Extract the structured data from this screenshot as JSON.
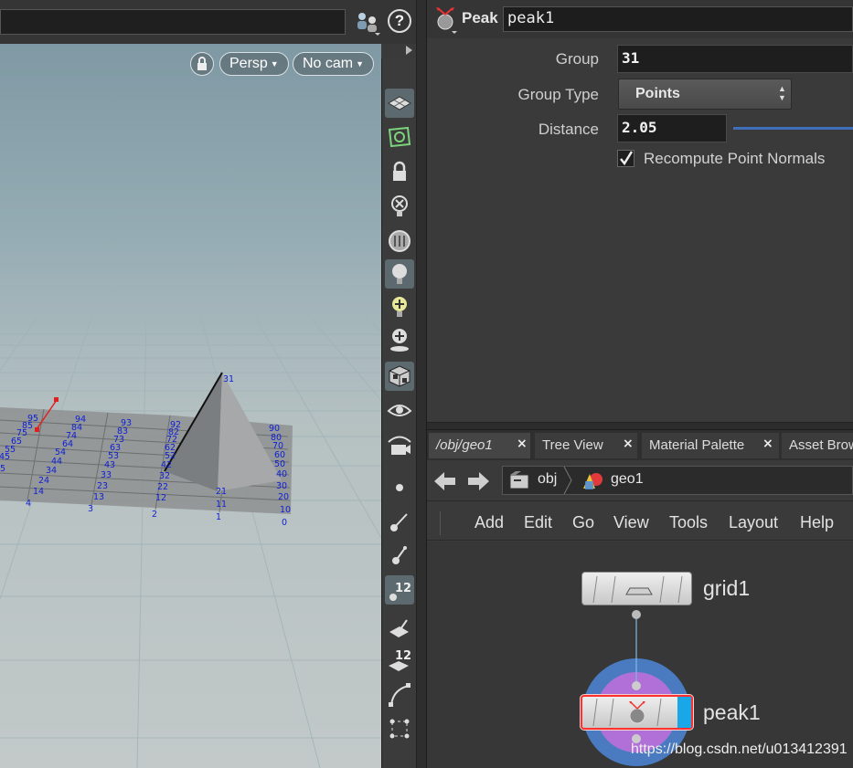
{
  "viewport": {
    "persp_label": "Persp",
    "cam_label": "No cam",
    "point_numbers": [
      "95",
      "94",
      "93",
      "92",
      "85",
      "84",
      "83",
      "82",
      "75",
      "74",
      "73",
      "72",
      "65",
      "64",
      "63",
      "62",
      "55",
      "54",
      "53",
      "52",
      "45",
      "44",
      "43",
      "42",
      "5",
      "34",
      "33",
      "32",
      "24",
      "23",
      "22",
      "14",
      "13",
      "12",
      "4",
      "3",
      "2",
      "31",
      "21",
      "11",
      "1",
      "90",
      "80",
      "70",
      "60",
      "50",
      "40",
      "30",
      "20",
      "10",
      "0"
    ]
  },
  "shelf": {
    "tool_badge_1": "12",
    "tool_badge_2": "12"
  },
  "parameters": {
    "node_type": "Peak",
    "node_name": "peak1",
    "group_label": "Group",
    "group_value": "31",
    "group_type_label": "Group Type",
    "group_type_value": "Points",
    "distance_label": "Distance",
    "distance_value": "2.05",
    "recompute_label": "Recompute Point Normals",
    "recompute_checked": true
  },
  "tabs": [
    {
      "label": "/obj/geo1",
      "active": true
    },
    {
      "label": "Tree View",
      "active": false
    },
    {
      "label": "Material Palette",
      "active": false
    },
    {
      "label": "Asset Brow",
      "active": false
    }
  ],
  "path": {
    "segment_1": "obj",
    "segment_2": "geo1"
  },
  "menu": [
    "Add",
    "Edit",
    "Go",
    "View",
    "Tools",
    "Layout",
    "Help"
  ],
  "network": {
    "node_1": "grid1",
    "node_2": "peak1"
  },
  "watermark": "https://blog.csdn.net/u013412391",
  "colors": {
    "accent_blue": "#3e6fb8",
    "highlight_ring": "#4a7bc0",
    "display_flag": "#1aa7e8",
    "point_number": "#1020d8"
  }
}
